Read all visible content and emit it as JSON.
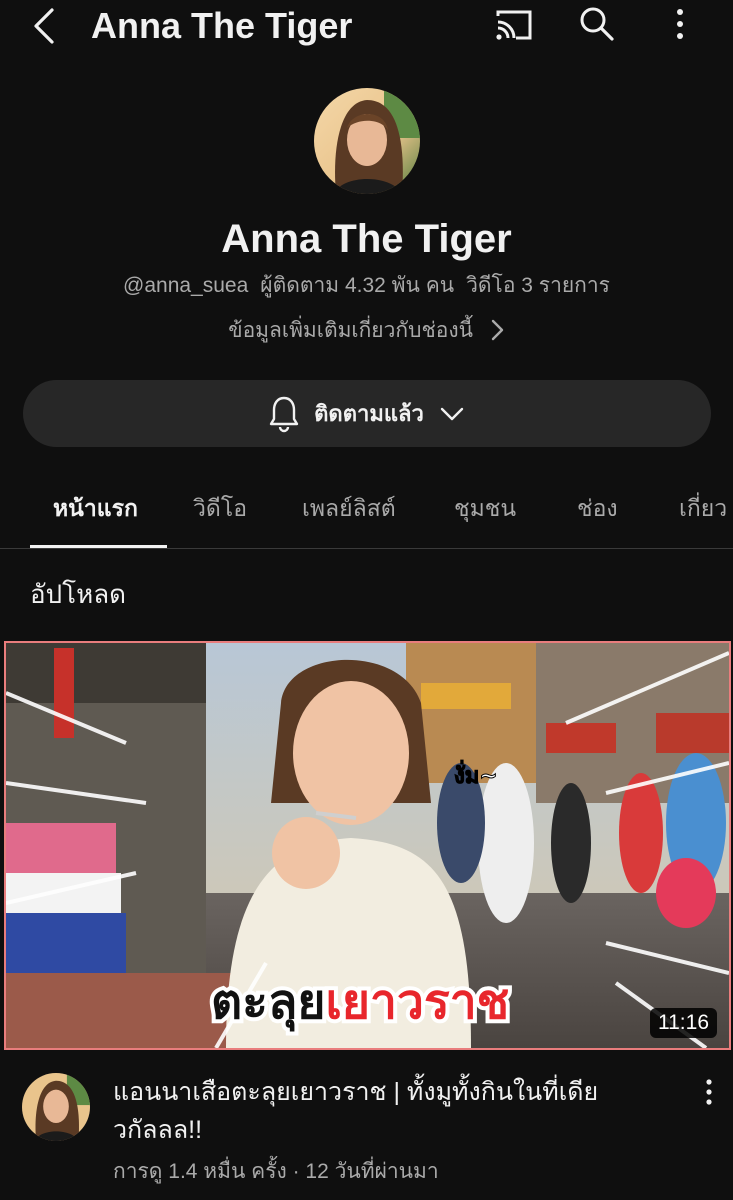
{
  "topbar": {
    "title": "Anna The Tiger",
    "icons": [
      "back-arrow-icon",
      "cast-icon",
      "search-icon",
      "more-vert-icon"
    ]
  },
  "channel": {
    "name": "Anna The Tiger",
    "handle": "@anna_suea",
    "subscribers": "ผู้ติดตาม 4.32 พัน คน",
    "videos": "วิดีโอ 3 รายการ",
    "more_info": "ข้อมูลเพิ่มเติมเกี่ยวกับช่องนี้",
    "subscribed_label": "ติดตามแล้ว"
  },
  "tabs": [
    {
      "label": "หน้าแรก",
      "active": true
    },
    {
      "label": "วิดีโอ",
      "active": false
    },
    {
      "label": "เพลย์ลิสต์",
      "active": false
    },
    {
      "label": "ชุมชน",
      "active": false
    },
    {
      "label": "ช่อง",
      "active": false
    },
    {
      "label": "เกี่ยว",
      "active": false
    }
  ],
  "section_title": "อัปโหลด",
  "video": {
    "thumbnail_caption_black": "ตะลุย",
    "thumbnail_caption_red": "เยาวราช",
    "thumbnail_sticker": "งั่ม~",
    "duration": "11:16",
    "title": "แอนนาเสือตะลุยเยาวราช | ทั้งมูทั้งกินในที่เดียวกัลลล!!",
    "meta": "การดู 1.4 หมื่น ครั้ง · 12 วันที่ผ่านมา"
  },
  "colors": {
    "background": "#0f0f0f",
    "button_bg": "#272727",
    "secondary_text": "#aaaaaa",
    "thumb_border": "#e97d7d",
    "caption_red": "#e8262c"
  }
}
